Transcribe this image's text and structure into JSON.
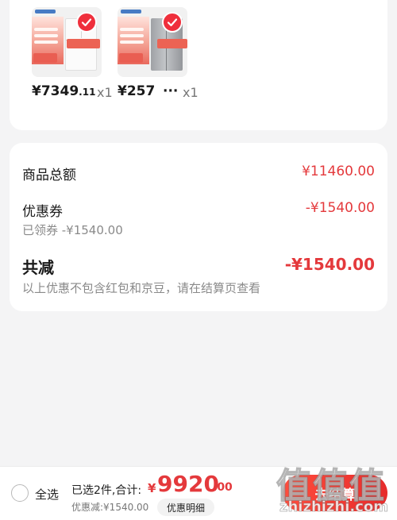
{
  "products": [
    {
      "price_main": "¥7349",
      "price_cents": ".11",
      "quantity": "x1",
      "selected": true,
      "image": "white-fridge-thumbnail"
    },
    {
      "price_main": "¥257",
      "price_cents": "",
      "truncation": "···",
      "quantity": "x1",
      "selected": true,
      "image": "gray-fridge-thumbnail"
    }
  ],
  "summary": {
    "subtotal_label": "商品总额",
    "subtotal_value": "¥11460.00",
    "coupon_label": "优惠券",
    "coupon_value": "-¥1540.00",
    "coupon_sub": "已领券 -¥1540.00",
    "total_discount_label": "共减",
    "total_discount_value": "-¥1540.00",
    "note": "以上优惠不包含红包和京豆，请在结算页查看"
  },
  "bottom_bar": {
    "select_all_label": "全选",
    "selected_summary": "已选2件,合计:",
    "currency_symbol": "¥",
    "total_main": "9920",
    "total_cents": ".00",
    "discount_line": "优惠减:¥1540.00",
    "detail_button": "优惠明细",
    "checkout_button": "去结算"
  },
  "watermark": {
    "big": "值值值",
    "small": "zhizhizhi.com"
  },
  "colors": {
    "accent_red": "#e4393c",
    "background": "#f4f4f5",
    "card": "#ffffff"
  }
}
